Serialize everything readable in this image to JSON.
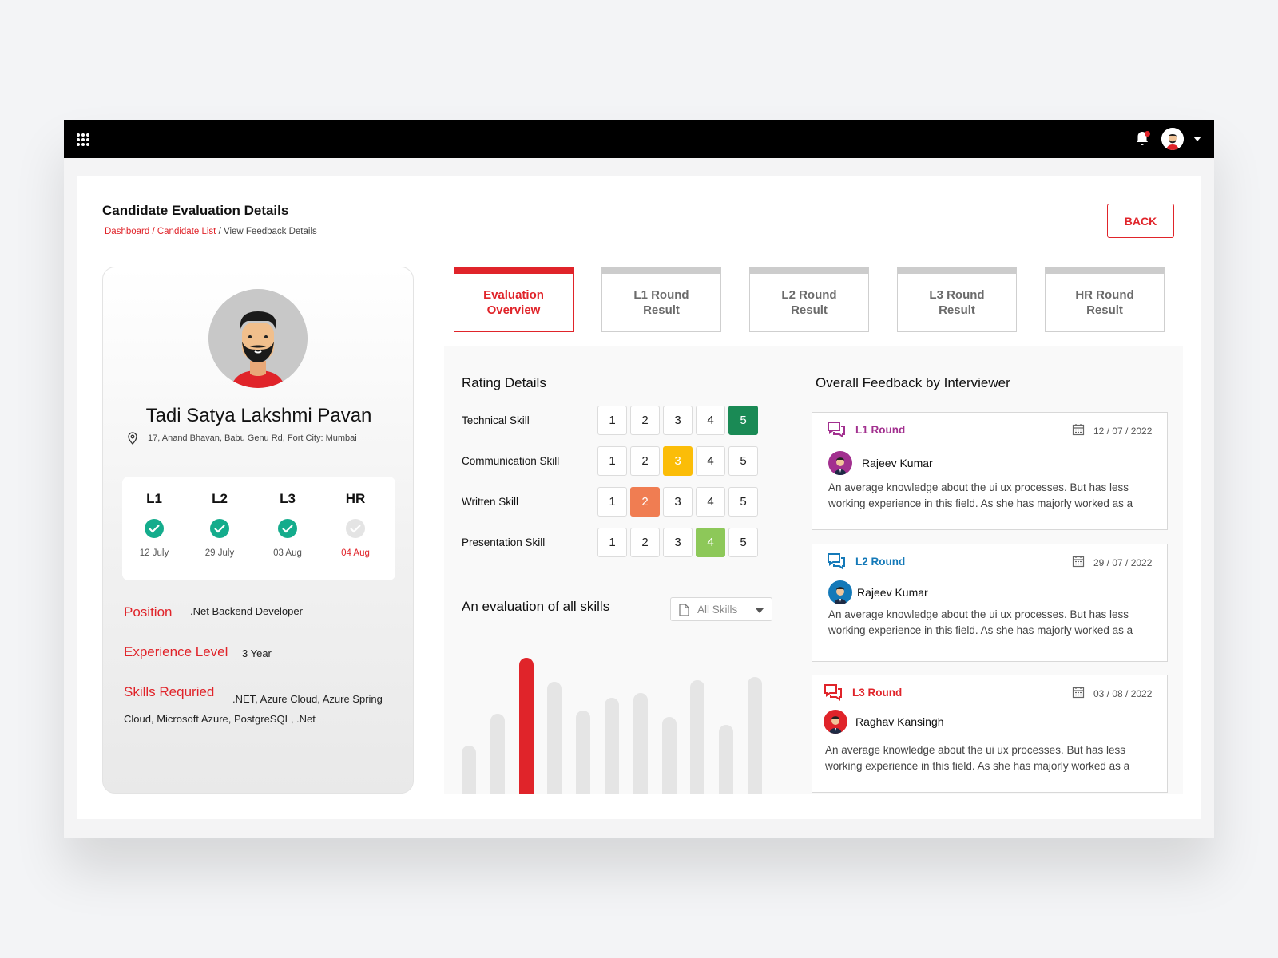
{
  "header": {
    "menu_icon": "grid-icon",
    "notification_icon": "bell-icon",
    "avatar_icon": "user-avatar"
  },
  "page": {
    "title": "Candidate Evaluation Details",
    "breadcrumb": {
      "link1": "Dashboard",
      "sep1": " / ",
      "link2": "Candidate List",
      "sep2": " / ",
      "current": "View Feedback Details"
    },
    "back_label": "BACK"
  },
  "candidate": {
    "name": "Tadi Satya Lakshmi Pavan",
    "address": "17, Anand Bhavan, Babu Genu Rd, Fort City: Mumbai",
    "rounds": [
      {
        "label": "L1",
        "date": "12  July",
        "status": "done"
      },
      {
        "label": "L2",
        "date": "29  July",
        "status": "done"
      },
      {
        "label": "L3",
        "date": "03  Aug",
        "status": "done"
      },
      {
        "label": "HR",
        "date": "04  Aug",
        "status": "pending"
      }
    ],
    "position_label": "Position",
    "position_value": ".Net Backend Developer",
    "experience_label": "Experience Level",
    "experience_value": "3 Year",
    "skills_label": "Skills Requried",
    "skills_value": ".NET, Azure Cloud, Azure Spring Cloud, Microsoft Azure, PostgreSQL, .Net"
  },
  "tabs": [
    {
      "label": "Evaluation Overview",
      "active": true
    },
    {
      "label": "L1 Round Result",
      "active": false
    },
    {
      "label": "L2 Round Result",
      "active": false
    },
    {
      "label": "L3 Round Result",
      "active": false
    },
    {
      "label": "HR Round Result",
      "active": false
    }
  ],
  "rating": {
    "title": "Rating Details",
    "scale": [
      "1",
      "2",
      "3",
      "4",
      "5"
    ],
    "skills": [
      {
        "name": "Technical Skill",
        "score": 5,
        "color": "#1a8a55"
      },
      {
        "name": "Communication Skill",
        "score": 3,
        "color": "#fbbd08"
      },
      {
        "name": "Written Skill",
        "score": 2,
        "color": "#f07d52"
      },
      {
        "name": "Presentation Skill",
        "score": 4,
        "color": "#8dc859"
      }
    ]
  },
  "evaluation": {
    "title": "An evaluation of all skills",
    "filter": "All Skills"
  },
  "chart_data": {
    "type": "bar",
    "highlight_index": 2,
    "highlight_color": "#e0242a",
    "base_color": "#e5e5e5",
    "values": [
      60,
      100,
      170,
      140,
      104,
      120,
      126,
      96,
      142,
      86,
      146
    ]
  },
  "feedback": {
    "title": "Overall Feedback by Interviewer",
    "items": [
      {
        "round": "L1 Round",
        "date": "12 / 07 / 2022",
        "interviewer": "Rajeev Kumar",
        "color": "#a2308f",
        "avatar_bg": "#a2308f",
        "text": "An average knowledge about the ui ux processes. But has less working experience in this field. As she has majorly worked as a"
      },
      {
        "round": "L2 Round",
        "date": "29 / 07 / 2022",
        "interviewer": "Rajeev Kumar",
        "color": "#1479b8",
        "avatar_bg": "#1479b8",
        "text": "An average knowledge about the ui ux processes. But has less working experience in this field. As she has majorly worked as a"
      },
      {
        "round": "L3 Round",
        "date": "03 / 08 / 2022",
        "interviewer": "Raghav Kansingh",
        "color": "#e0242a",
        "avatar_bg": "#e0242a",
        "text": "An average knowledge about the ui ux processes. But has less working experience in this field. As she has majorly worked as a"
      }
    ]
  }
}
